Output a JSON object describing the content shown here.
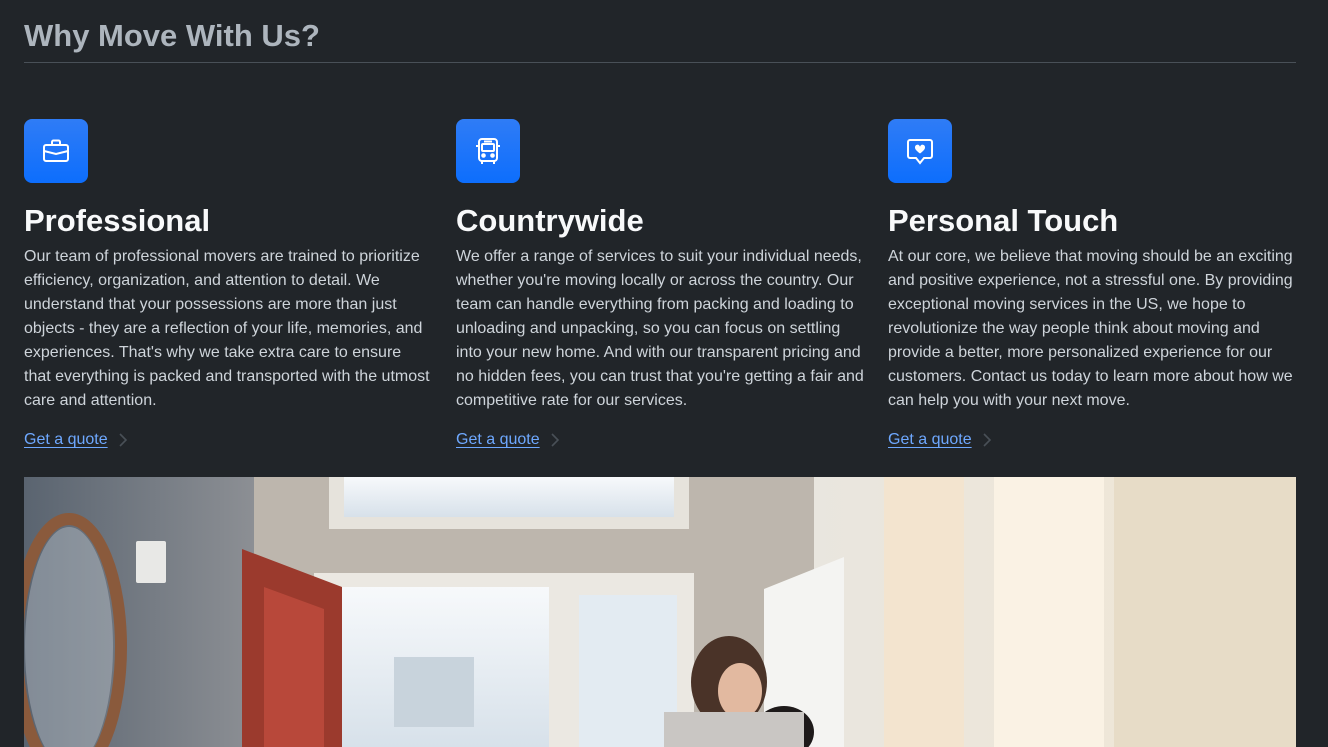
{
  "section": {
    "title": "Why Move With Us?"
  },
  "features": [
    {
      "icon": "briefcase-icon",
      "title": "Professional",
      "text": "Our team of professional movers are trained to prioritize efficiency, organization, and attention to detail. We understand that your possessions are more than just objects - they are a reflection of your life, memories, and experiences. That's why we take extra care to ensure that everything is packed and transported with the utmost care and attention.",
      "link": "Get a quote"
    },
    {
      "icon": "bus-icon",
      "title": "Countrywide",
      "text": "We offer a range of services to suit your individual needs, whether you're moving locally or across the country. Our team can handle everything from packing and loading to unloading and unpacking, so you can focus on settling into your new home. And with our transparent pricing and no hidden fees, you can trust that you're getting a fair and competitive rate for our services.",
      "link": "Get a quote"
    },
    {
      "icon": "chat-heart-icon",
      "title": "Personal Touch",
      "text": "At our core, we believe that moving should be an exciting and positive experience, not a stressful one. By providing exceptional moving services in the US, we hope to revolutionize the way people think about moving and provide a better, more personalized experience for our customers. Contact us today to learn more about how we can help you with your next move.",
      "link": "Get a quote"
    }
  ],
  "colors": {
    "background": "#212529",
    "accent": "#0d6efd",
    "link": "#6ea8fe"
  }
}
